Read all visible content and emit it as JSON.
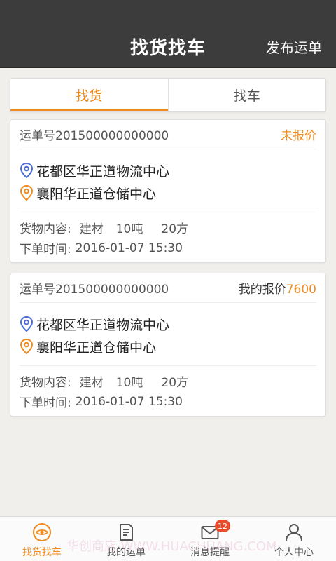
{
  "header": {
    "title": "找货找车",
    "action_label": "发布运单"
  },
  "tabs": [
    {
      "label": "找货",
      "active": true
    },
    {
      "label": "找车",
      "active": false
    }
  ],
  "orders": [
    {
      "waybill": "运单号201500000000000",
      "status": "未报价",
      "origin": "花都区华正道物流中心",
      "destination": "襄阳华正道仓储中心",
      "cargo_label": "货物内容:",
      "cargo_type": "建材",
      "cargo_weight": "10吨",
      "cargo_volume": "20方",
      "time_label": "下单时间:",
      "time_value": "2016-01-07 15:30"
    },
    {
      "waybill": "运单号201500000000000",
      "quote_label": "我的报价",
      "quote_value": "7600",
      "origin": "花都区华正道物流中心",
      "destination": "襄阳华正道仓储中心",
      "cargo_label": "货物内容:",
      "cargo_type": "建材",
      "cargo_weight": "10吨",
      "cargo_volume": "20方",
      "time_label": "下单时间:",
      "time_value": "2016-01-07 15:30"
    }
  ],
  "bottom_nav": [
    {
      "label": "找货找车",
      "icon": "eye-icon",
      "active": true
    },
    {
      "label": "我的运单",
      "icon": "document-icon",
      "active": false
    },
    {
      "label": "消息提醒",
      "icon": "mail-icon",
      "active": false,
      "badge": "12"
    },
    {
      "label": "个人中心",
      "icon": "person-icon",
      "active": false
    }
  ],
  "watermark": "华创商店 WWW.HUACHUANG.COM",
  "colors": {
    "accent": "#f08a1c",
    "header_bg": "#3c3c3c",
    "origin_pin": "#4a6fd6",
    "destination_pin": "#f08a1c",
    "badge": "#e64b2c"
  }
}
